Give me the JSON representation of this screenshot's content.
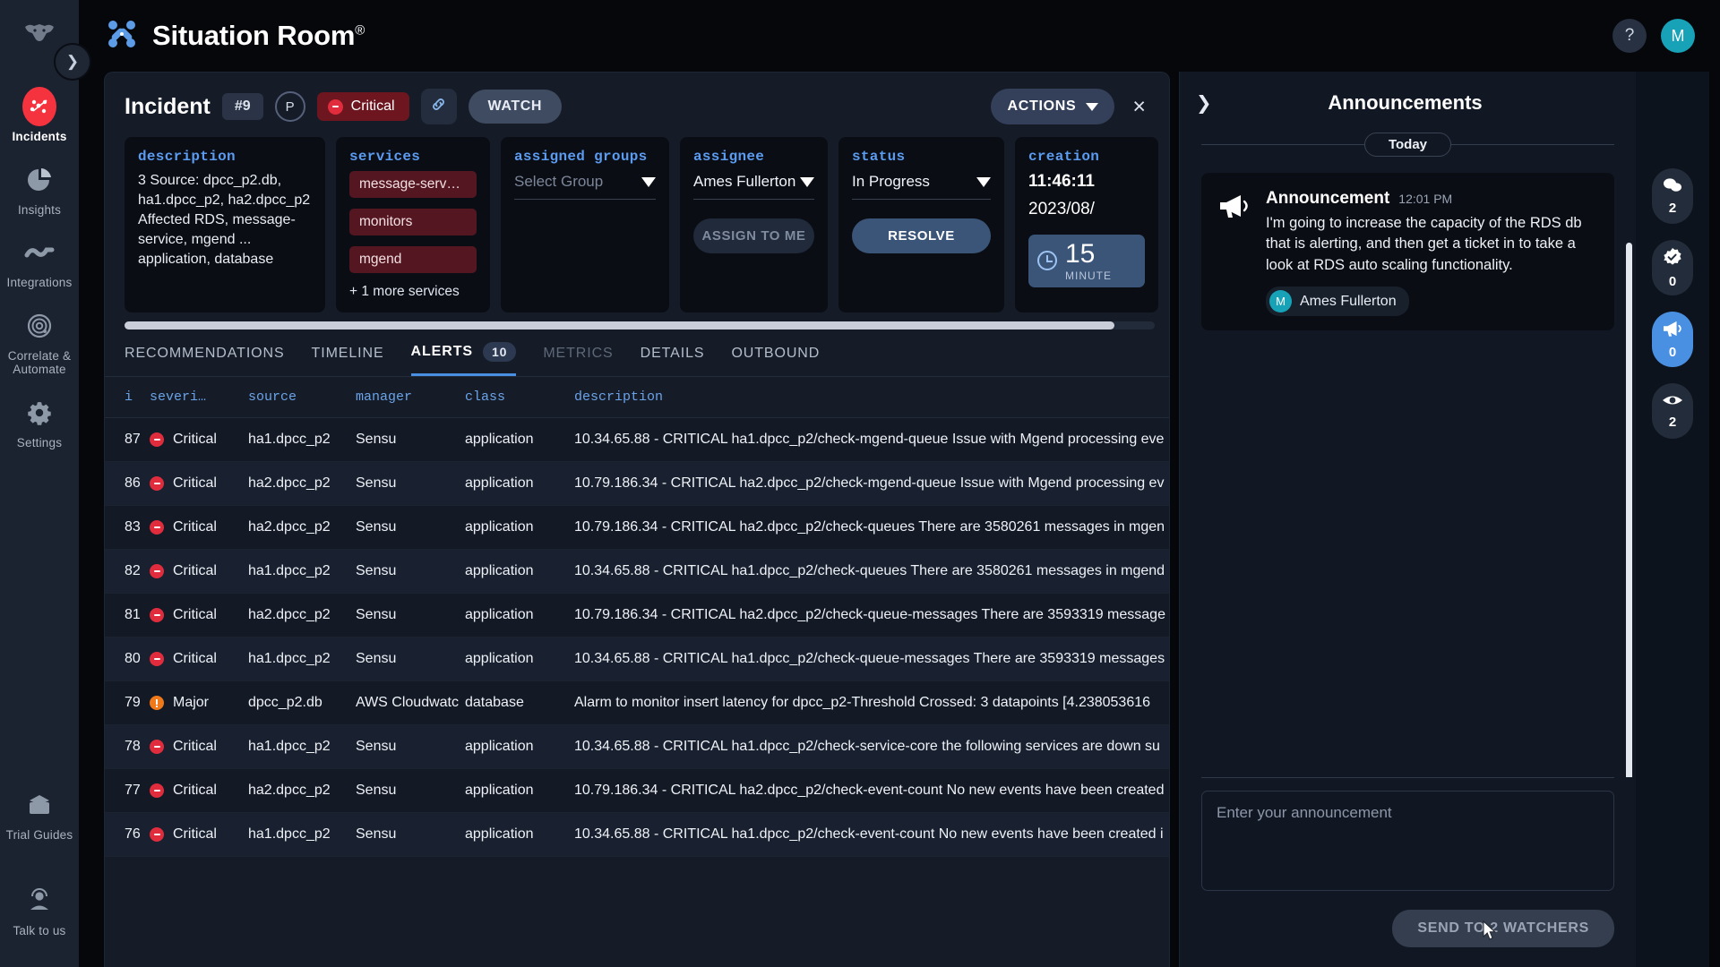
{
  "app": {
    "brand_title": "Situation Room",
    "brand_sup": "®",
    "help_label": "?",
    "user_initial": "M"
  },
  "left_rail": {
    "expand_icon": "chevron-right-icon",
    "items": [
      {
        "label": "Incidents",
        "icon": "incidents-icon",
        "active": true
      },
      {
        "label": "Insights",
        "icon": "pie-chart-icon",
        "active": false
      },
      {
        "label": "Integrations",
        "icon": "integrations-icon",
        "active": false
      },
      {
        "label": "Correlate &\nAutomate",
        "icon": "radar-icon",
        "active": false
      },
      {
        "label": "Settings",
        "icon": "gear-icon",
        "active": false
      }
    ],
    "bottom_items": [
      {
        "label": "Trial Guides",
        "icon": "guide-icon"
      },
      {
        "label": "Talk to us",
        "icon": "support-agent-icon"
      }
    ]
  },
  "incident": {
    "title": "Incident",
    "number": "#9",
    "priority": "P",
    "severity": "Critical",
    "link_icon": "link-icon",
    "watch_label": "WATCH",
    "actions_label": "ACTIONS",
    "close_label": "×",
    "fields": {
      "description": {
        "label": "description",
        "value": "3 Source: dpcc_p2.db, ha1.dpcc_p2, ha2.dpcc_p2 Affected RDS, message-service, mgend ... application, database"
      },
      "services": {
        "label": "services",
        "pills": [
          "message-serv…",
          "monitors",
          "mgend"
        ],
        "more": "+ 1 more services"
      },
      "assigned_groups": {
        "label": "assigned groups",
        "placeholder": "Select Group"
      },
      "assignee": {
        "label": "assignee",
        "value": "Ames Fullerton",
        "button": "ASSIGN TO ME"
      },
      "status": {
        "label": "status",
        "value": "In Progress",
        "button": "RESOLVE"
      },
      "creation": {
        "label": "creation",
        "time": "11:46:11",
        "date": "2023/08/",
        "timer_value": "15",
        "timer_unit": "MINUTE"
      }
    },
    "tabs": [
      {
        "label": "RECOMMENDATIONS",
        "state": "normal",
        "count": null
      },
      {
        "label": "TIMELINE",
        "state": "normal",
        "count": null
      },
      {
        "label": "ALERTS",
        "state": "active",
        "count": "10"
      },
      {
        "label": "METRICS",
        "state": "dim",
        "count": null
      },
      {
        "label": "DETAILS",
        "state": "normal",
        "count": null
      },
      {
        "label": "OUTBOUND",
        "state": "normal",
        "count": null
      }
    ],
    "table": {
      "columns": [
        "i",
        "severi…",
        "source",
        "manager",
        "class",
        "description"
      ],
      "rows": [
        {
          "i": "87",
          "severity": "Critical",
          "sev_level": "critical",
          "source": "ha1.dpcc_p2",
          "manager": "Sensu",
          "class": "application",
          "description": "10.34.65.88 - CRITICAL ha1.dpcc_p2/check-mgend-queue Issue with Mgend processing eve"
        },
        {
          "i": "86",
          "severity": "Critical",
          "sev_level": "critical",
          "source": "ha2.dpcc_p2",
          "manager": "Sensu",
          "class": "application",
          "description": "10.79.186.34 - CRITICAL ha2.dpcc_p2/check-mgend-queue Issue with Mgend processing ev"
        },
        {
          "i": "83",
          "severity": "Critical",
          "sev_level": "critical",
          "source": "ha2.dpcc_p2",
          "manager": "Sensu",
          "class": "application",
          "description": "10.79.186.34 - CRITICAL ha2.dpcc_p2/check-queues There are 3580261 messages in mgen"
        },
        {
          "i": "82",
          "severity": "Critical",
          "sev_level": "critical",
          "source": "ha1.dpcc_p2",
          "manager": "Sensu",
          "class": "application",
          "description": "10.34.65.88 - CRITICAL ha1.dpcc_p2/check-queues There are 3580261 messages in mgend"
        },
        {
          "i": "81",
          "severity": "Critical",
          "sev_level": "critical",
          "source": "ha2.dpcc_p2",
          "manager": "Sensu",
          "class": "application",
          "description": "10.79.186.34 - CRITICAL ha2.dpcc_p2/check-queue-messages There are 3593319 message"
        },
        {
          "i": "80",
          "severity": "Critical",
          "sev_level": "critical",
          "source": "ha1.dpcc_p2",
          "manager": "Sensu",
          "class": "application",
          "description": "10.34.65.88 - CRITICAL ha1.dpcc_p2/check-queue-messages There are 3593319 messages"
        },
        {
          "i": "79",
          "severity": "Major",
          "sev_level": "major",
          "source": "dpcc_p2.db",
          "manager": "AWS Cloudwatc",
          "class": "database",
          "description": "Alarm to monitor insert latency for dpcc_p2-Threshold Crossed: 3 datapoints [4.238053616"
        },
        {
          "i": "78",
          "severity": "Critical",
          "sev_level": "critical",
          "source": "ha1.dpcc_p2",
          "manager": "Sensu",
          "class": "application",
          "description": "10.34.65.88 - CRITICAL ha1.dpcc_p2/check-service-core the following services are down su"
        },
        {
          "i": "77",
          "severity": "Critical",
          "sev_level": "critical",
          "source": "ha2.dpcc_p2",
          "manager": "Sensu",
          "class": "application",
          "description": "10.79.186.34 - CRITICAL ha2.dpcc_p2/check-event-count No new events have been created"
        },
        {
          "i": "76",
          "severity": "Critical",
          "sev_level": "critical",
          "source": "ha1.dpcc_p2",
          "manager": "Sensu",
          "class": "application",
          "description": "10.34.65.88 - CRITICAL ha1.dpcc_p2/check-event-count No new events have been created i"
        }
      ]
    }
  },
  "announcements": {
    "title": "Announcements",
    "collapse_icon": "chevron-right-icon",
    "date_divider": "Today",
    "cards": [
      {
        "icon": "megaphone-icon",
        "type": "Announcement",
        "time": "12:01 PM",
        "text": "I'm going to increase the capacity of the RDS db that is alerting, and then get a ticket in to take a look at RDS auto scaling functionality.",
        "author_initial": "M",
        "author": "Ames Fullerton"
      }
    ],
    "input_placeholder": "Enter your announcement",
    "send_label": "SEND TO 2 WATCHERS"
  },
  "right_rail": {
    "items": [
      {
        "icon": "comments-icon",
        "count": "2",
        "selected": false
      },
      {
        "icon": "verified-badge-icon",
        "count": "0",
        "selected": false
      },
      {
        "icon": "megaphone-icon",
        "count": "0",
        "selected": true
      },
      {
        "icon": "eye-icon",
        "count": "2",
        "selected": false
      }
    ]
  },
  "colors": {
    "accent_blue": "#4a90e2",
    "critical_red": "#e02c3c",
    "major_orange": "#f07a1a",
    "avatar_teal": "#17a2b8",
    "panel_bg": "#151c28"
  }
}
